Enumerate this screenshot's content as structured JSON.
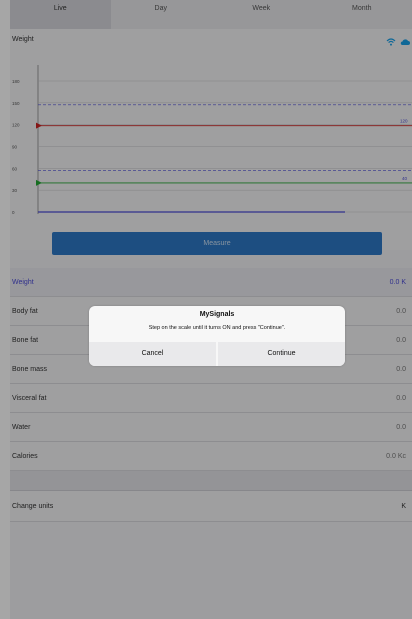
{
  "tabs": [
    {
      "label": "Live",
      "active": true
    },
    {
      "label": "Day",
      "active": false
    },
    {
      "label": "Week",
      "active": false
    },
    {
      "label": "Month",
      "active": false
    }
  ],
  "chart": {
    "label": "Weight",
    "icons": [
      "wifi-icon",
      "cloud-icon"
    ]
  },
  "chart_data": {
    "type": "line",
    "yticks": [
      "180",
      "150",
      "120",
      "90",
      "60",
      "30",
      "0"
    ],
    "threshold_labels": [
      "120",
      "40"
    ],
    "colors": {
      "upper_line": "#cc2222",
      "lower_line": "#22aa33",
      "dashed": "#4b4bd8",
      "baseline": "#4b4bd8"
    }
  },
  "measure_label": "Measure",
  "list": [
    {
      "label": "Weight",
      "value": "0.0 K"
    },
    {
      "label": "Body fat",
      "value": "0.0"
    },
    {
      "label": "Bone fat",
      "value": "0.0"
    },
    {
      "label": "Bone mass",
      "value": "0.0"
    },
    {
      "label": "Visceral fat",
      "value": "0.0"
    },
    {
      "label": "Water",
      "value": "0.0"
    },
    {
      "label": "Calories",
      "value": "0.0 Kc"
    }
  ],
  "change_units": {
    "label": "Change units",
    "value": "K"
  },
  "dialog": {
    "title": "MySignals",
    "message": "Step on the scale until it turns ON and press \"Continue\".",
    "cancel": "Cancel",
    "continue": "Continue"
  }
}
